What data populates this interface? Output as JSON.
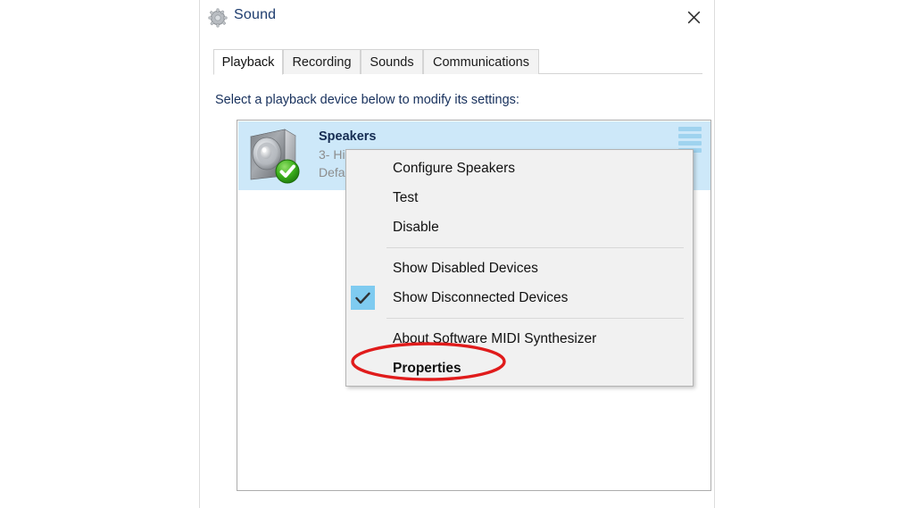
{
  "window": {
    "title": "Sound",
    "title_icon": "speaker-settings-icon",
    "close_icon": "close-icon",
    "accent_selection_color": "#cde8f9",
    "title_text_color": "#1d3c6e"
  },
  "tabs": [
    {
      "label": "Playback",
      "active": true
    },
    {
      "label": "Recording",
      "active": false
    },
    {
      "label": "Sounds",
      "active": false
    },
    {
      "label": "Communications",
      "active": false
    }
  ],
  "playback_pane": {
    "instruction": "Select a playback device below to modify its settings:",
    "devices": [
      {
        "name": "Speakers",
        "line2": "3- Hi",
        "line3": "Defa",
        "icon": "speaker-icon",
        "status_badge": "green-check-badge",
        "selected": true,
        "meter": "vu-meter"
      }
    ]
  },
  "context_menu": {
    "items": [
      {
        "label": "Configure Speakers",
        "type": "item",
        "checked": false,
        "bold": false
      },
      {
        "label": "Test",
        "type": "item",
        "checked": false,
        "bold": false
      },
      {
        "label": "Disable",
        "type": "item",
        "checked": false,
        "bold": false
      },
      {
        "type": "separator"
      },
      {
        "label": "Show Disabled Devices",
        "type": "item",
        "checked": false,
        "bold": false
      },
      {
        "label": "Show Disconnected Devices",
        "type": "item",
        "checked": true,
        "bold": false
      },
      {
        "type": "separator"
      },
      {
        "label": "About Software MIDI Synthesizer",
        "type": "item",
        "checked": false,
        "bold": false
      },
      {
        "label": "Properties",
        "type": "item",
        "checked": false,
        "bold": true
      }
    ],
    "check_highlight_color": "#7fcbf0"
  },
  "annotation": {
    "shape": "ellipse",
    "color": "#e01b1b",
    "target_label": "Properties"
  }
}
